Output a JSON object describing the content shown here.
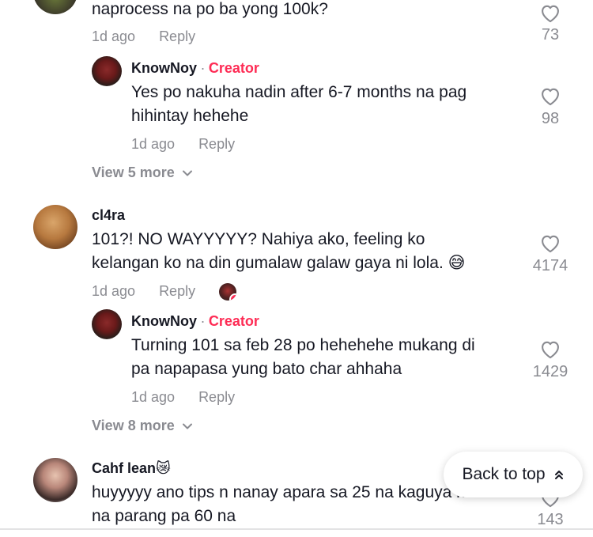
{
  "comments": [
    {
      "text_lines": [
        "naprocess na po ba yong 100k?"
      ],
      "time": "1d ago",
      "reply_label": "Reply",
      "likes": "73",
      "replies": [
        {
          "username": "KnowNoy",
          "separator": "·",
          "badge": "Creator",
          "text_lines": [
            "Yes po nakuha nadin after 6-7 months na pag",
            "hihintay hehehe"
          ],
          "time": "1d ago",
          "reply_label": "Reply",
          "likes": "98"
        }
      ],
      "view_more": "View 5 more"
    },
    {
      "username": "cl4ra",
      "text_lines": [
        "101?! NO WAYYYYY? Nahiya ako, feeling ko",
        "kelangan ko na din gumalaw galaw gaya ni lola. 😅"
      ],
      "time": "1d ago",
      "reply_label": "Reply",
      "likes": "4174",
      "replies": [
        {
          "username": "KnowNoy",
          "separator": "·",
          "badge": "Creator",
          "text_lines": [
            "Turning 101 sa feb 28 po hehehehe mukang di",
            "pa napapasa yung bato char ahhaha"
          ],
          "time": "1d ago",
          "reply_label": "Reply",
          "likes": "1429"
        }
      ],
      "view_more": "View 8 more"
    },
    {
      "username": "Cahf lean😿",
      "text_lines": [
        "huyyyyy ano tips n nanay apara sa 25 na kaguya ko",
        "na parang pa 60 na"
      ],
      "likes": "143"
    }
  ],
  "back_to_top": {
    "label": "Back to top",
    "icon": "double-chevron-up-icon"
  },
  "icons": {
    "like": "heart-outline-icon",
    "view_more": "chevron-down-icon"
  },
  "colors": {
    "creator": "#fe2c55",
    "secondary_text": "#8a8b91",
    "primary_text": "#161823"
  }
}
